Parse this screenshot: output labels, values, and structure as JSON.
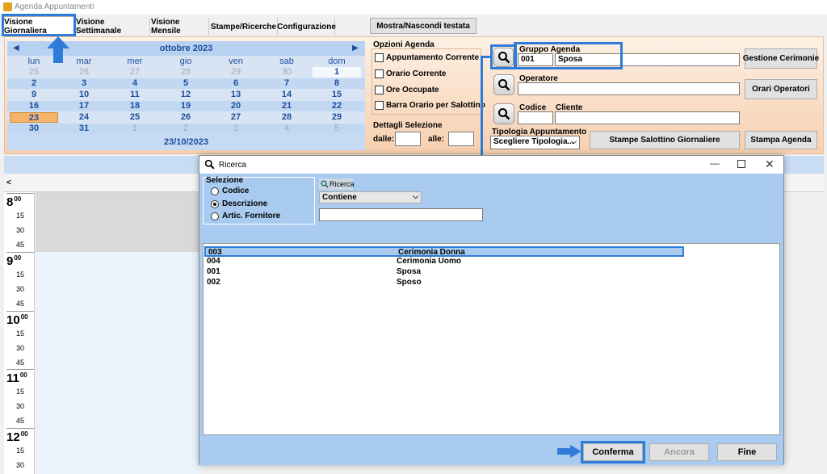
{
  "window": {
    "title": "Agenda Appuntamenti"
  },
  "tabs": [
    "Visione Giornaliera",
    "Visione Settimanale",
    "Visione Mensile",
    "Stampe/Ricerche",
    "Configurazione"
  ],
  "toggle_header_btn": "Mostra/Nascondi testata",
  "calendar": {
    "month_title": "ottobre 2023",
    "weekdays": [
      "lun",
      "mar",
      "mer",
      "gio",
      "ven",
      "sab",
      "dom"
    ],
    "weeks": [
      [
        "25",
        "26",
        "27",
        "28",
        "29",
        "30",
        "1"
      ],
      [
        "2",
        "3",
        "4",
        "5",
        "6",
        "7",
        "8"
      ],
      [
        "9",
        "10",
        "11",
        "12",
        "13",
        "14",
        "15"
      ],
      [
        "16",
        "17",
        "18",
        "19",
        "20",
        "21",
        "22"
      ],
      [
        "23",
        "24",
        "25",
        "26",
        "27",
        "28",
        "29"
      ],
      [
        "30",
        "31",
        "1",
        "2",
        "3",
        "4",
        "5"
      ]
    ],
    "selected_date": "23/10/2023"
  },
  "options": {
    "title": "Opzioni Agenda",
    "items": [
      "Appuntamento Corrente",
      "Orario Corrente",
      "Ore Occupate",
      "Barra Orario per Salottino"
    ],
    "details_title": "Dettagli Selezione",
    "from_label": "dalle:",
    "to_label": "alle:"
  },
  "group": {
    "label": "Gruppo Agenda",
    "code": "001",
    "name": "Sposa",
    "button": "Gestione Cerimonie"
  },
  "operator": {
    "label": "Operatore",
    "button": "Orari Operatori"
  },
  "client": {
    "code_label": "Codice",
    "client_label": "Cliente"
  },
  "type": {
    "label": "Tipologia Appuntamento",
    "value": "Scegliere Tipologia..."
  },
  "print_salottino": "Stampe Salottino Giornaliere",
  "print_agenda": "Stampa Agenda",
  "schedule": {
    "nav_left": "<",
    "hours": [
      "8",
      "9",
      "10",
      "11",
      "12"
    ],
    "hour_sup": "00",
    "minutes": [
      "15",
      "30",
      "45"
    ]
  },
  "dialog": {
    "title": "Ricerca",
    "selection_title": "Selezione",
    "radios": [
      "Codice",
      "Descrizione",
      "Artic. Fornitore"
    ],
    "search_label": "Ricerca",
    "match_mode": "Contiene",
    "search_value": "",
    "rows": [
      {
        "code": "003",
        "desc": "Cerimonia Donna"
      },
      {
        "code": "004",
        "desc": "Cerimonia Uomo"
      },
      {
        "code": "001",
        "desc": "Sposa"
      },
      {
        "code": "002",
        "desc": "Sposo"
      }
    ],
    "buttons": {
      "confirm": "Conferma",
      "more": "Ancora",
      "end": "Fine"
    }
  }
}
